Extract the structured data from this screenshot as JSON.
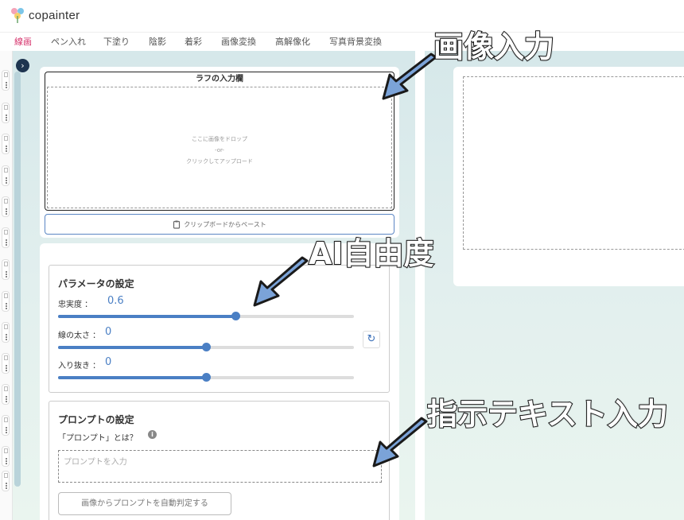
{
  "app": {
    "name": "copainter"
  },
  "nav": {
    "tabs": [
      {
        "label": "線画",
        "active": true
      },
      {
        "label": "ペン入れ",
        "active": false
      },
      {
        "label": "下塗り",
        "active": false
      },
      {
        "label": "陰影",
        "active": false
      },
      {
        "label": "着彩",
        "active": false
      },
      {
        "label": "画像変換",
        "active": false
      },
      {
        "label": "高解像化",
        "active": false
      },
      {
        "label": "写真背景変換",
        "active": false
      }
    ]
  },
  "upload": {
    "title": "ラフの入力欄",
    "drop_line1": "ここに画像をドロップ",
    "drop_line2": "-or-",
    "drop_line3": "クリックしてアップロード",
    "paste_label": "クリップボードからペースト"
  },
  "params": {
    "title": "パラメータの設定",
    "fidelity": {
      "label": "忠実度 ：",
      "value": "0.6",
      "level": 0.6
    },
    "line_width": {
      "label": "線の太さ ：",
      "value": "0",
      "level": 0.5
    },
    "taper": {
      "label": "入り抜き ：",
      "value": "0",
      "level": 0.5
    }
  },
  "prompt": {
    "title": "プロンプトの設定",
    "help_text": "「プロンプト」とは？",
    "placeholder": "プロンプトを入力",
    "auto_button": "画像からプロンプトを自動判定する"
  },
  "annotations": {
    "image_input": "画像入力",
    "ai_freedom": "AI自由度",
    "prompt_input": "指示テキスト入力"
  },
  "colors": {
    "active_tab": "#d6336c",
    "accent": "#4a7fc4",
    "annotation_arrow": "#7ba3d8"
  }
}
